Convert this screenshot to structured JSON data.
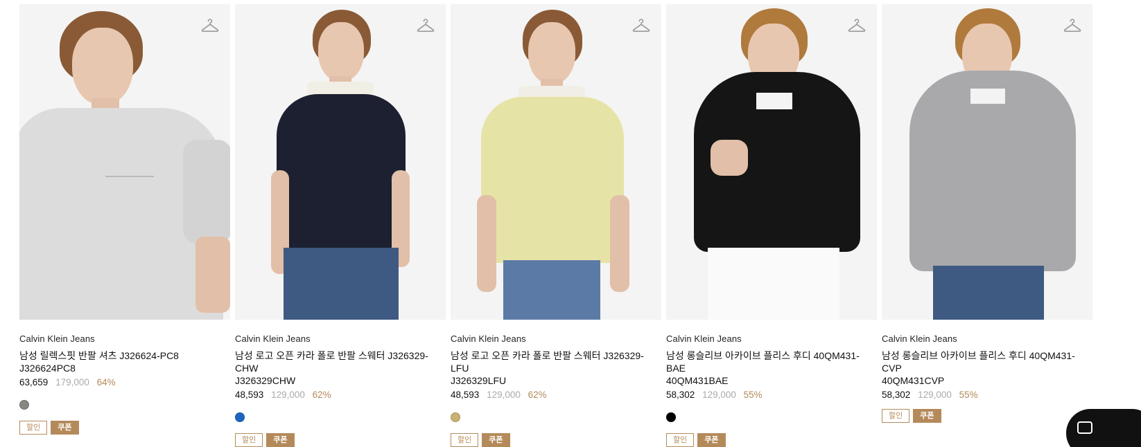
{
  "products": [
    {
      "brand": "Calvin Klein Jeans",
      "name": "남성 릴렉스핏 반팔 셔츠 J326624-PC8\nJ326624PC8",
      "price": "63,659",
      "original_price": "179,000",
      "discount": "64%",
      "swatch_color": "#858780",
      "badges": [
        "할인",
        "쿠폰"
      ],
      "garment_color": "#dcdcdc"
    },
    {
      "brand": "Calvin Klein Jeans",
      "name": "남성 로고 오픈 카라 폴로 반팔 스웨터 J326329-CHW\nJ326329CHW",
      "price": "48,593",
      "original_price": "129,000",
      "discount": "62%",
      "swatch_color": "#1d66c0",
      "badges": [
        "할인",
        "쿠폰"
      ],
      "garment_color": "#1c2030"
    },
    {
      "brand": "Calvin Klein Jeans",
      "name": "남성 로고 오픈 카라 폴로 반팔 스웨터 J326329-LFU\nJ326329LFU",
      "price": "48,593",
      "original_price": "129,000",
      "discount": "62%",
      "swatch_color": "#c8b173",
      "badges": [
        "할인",
        "쿠폰"
      ],
      "garment_color": "#e6e3a6"
    },
    {
      "brand": "Calvin Klein Jeans",
      "name": "남성 롱슬리브 아카이브 플리스 후디 40QM431-BAE\n40QM431BAE",
      "price": "58,302",
      "original_price": "129,000",
      "discount": "55%",
      "swatch_color": "#000000",
      "badges": [
        "할인",
        "쿠폰"
      ],
      "garment_color": "#151515"
    },
    {
      "brand": "Calvin Klein Jeans",
      "name": "남성 롱슬리브 아카이브 플리스 후디 40QM431-CVP\n40QM431CVP",
      "price": "58,302",
      "original_price": "129,000",
      "discount": "55%",
      "badges": [
        "할인",
        "쿠폰"
      ],
      "garment_color": "#a9a9ab"
    }
  ],
  "icons": {
    "wishlist": "hanger-icon"
  },
  "colors": {
    "accent": "#b48a5a"
  }
}
